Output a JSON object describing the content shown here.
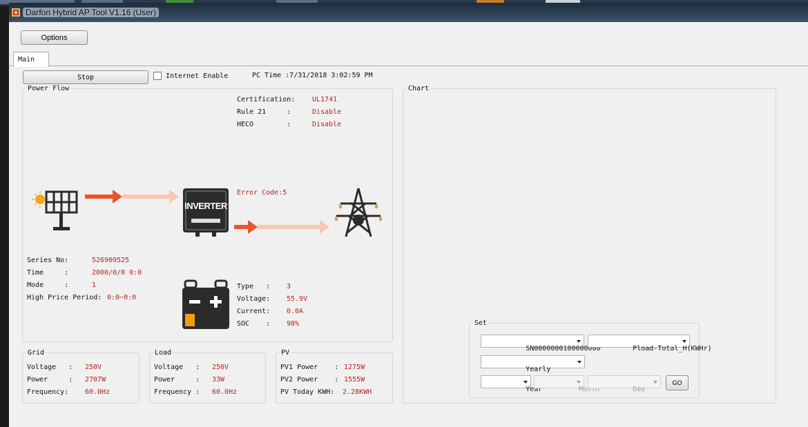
{
  "window": {
    "title": "Darfon Hybrid AP Tool V1.16 (User)"
  },
  "toolbar": {
    "options_label": "Options"
  },
  "tabs": [
    {
      "label": "Main",
      "selected": true
    }
  ],
  "controls": {
    "stop_label": "Stop",
    "internet_label": "Internet Enable",
    "internet_checked": false,
    "pc_time": "PC Time :7/31/2018 3:02:59 PM"
  },
  "power_flow": {
    "title": "Power Flow",
    "certification_label": "Certification:",
    "certification_value": "UL1741",
    "rule21_label": "Rule 21     :",
    "rule21_value": "Disable",
    "heco_label": "HECO        :",
    "heco_value": "Disable",
    "error_code": "Error Code:5",
    "inverter_label": "INVERTER",
    "series_label": "Series No:",
    "series_value": "526909525",
    "time_label": "Time     :",
    "time_value": "2000/0/0 0:0",
    "mode_label": "Mode     :",
    "mode_value": "1",
    "high_price_label": "High Price Period:",
    "high_price_value": "0:0~0:0",
    "battery": {
      "type_label": "Type   :",
      "type_value": "3",
      "voltage_label": "Voltage:",
      "voltage_value": "55.9V",
      "current_label": "Current:",
      "current_value": "0.0A",
      "soc_label": "SOC    :",
      "soc_value": "98%"
    },
    "icons": [
      "sun-icon",
      "solar-panel-icon",
      "inverter-icon",
      "battery-icon",
      "power-tower-icon",
      "flow-arrow-icon"
    ]
  },
  "chart": {
    "title": "Chart"
  },
  "grid": {
    "title": "Grid",
    "voltage_label": "Voltage   :",
    "voltage_value": "250V",
    "power_label": "Power     :",
    "power_value": "2707W",
    "frequency_label": "Frequency:",
    "frequency_value": "60.0Hz"
  },
  "load": {
    "title": "Load",
    "voltage_label": "Voltage   :",
    "voltage_value": "250V",
    "power_label": "Power     :",
    "power_value": "33W",
    "frequency_label": "Frequency :",
    "frequency_value": "60.0Hz"
  },
  "pv": {
    "title": "PV",
    "pv1_label": "PV1 Power    :",
    "pv1_value": "1275W",
    "pv2_label": "PV2 Power    :",
    "pv2_value": "1555W",
    "today_label": "PV Today KWH:",
    "today_value": "2.28KWH"
  },
  "set": {
    "title": "Set",
    "serial_select": "SN0000000100000000",
    "metric_select": "Pload-Total_H(KWHr)",
    "period_select": "Yearly",
    "year_select": "Year",
    "month_select": "Month",
    "day_select": "Day",
    "go_label": "GO"
  },
  "colors": {
    "value_red": "#b22222",
    "arrow_orange": "#e8562a",
    "arrow_fade": "#f6c8b4",
    "sun_orange": "#f5a623",
    "battery_orange": "#f39c12",
    "icon_dark": "#2b2b2b"
  }
}
